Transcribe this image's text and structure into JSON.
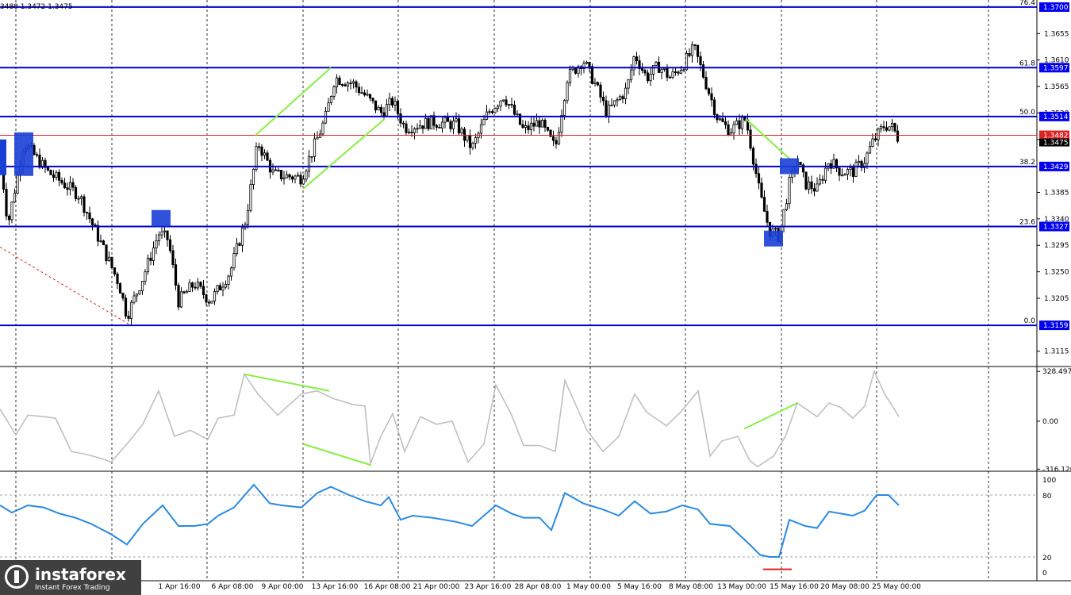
{
  "header": {
    "ohlc_text": "3480 1.3472 1.3475"
  },
  "brand": {
    "name": "instaforex",
    "tagline": "Instant Forex Trading"
  },
  "colors": {
    "level": "#0000cc",
    "level_label_bg": "#0000ee",
    "current_price": "#dd2222",
    "trend_green": "#88ee44",
    "marker_blue": "#1a3fd6",
    "oscillator": "#c0c0c0",
    "rsi": "#2a8ae0",
    "candle": "#000000",
    "grid": "#000000"
  },
  "chart_data": [
    {
      "type": "candlestick",
      "pane": "price",
      "title": "",
      "x_labels": [
        "1 Apr 16:00",
        "6 Apr 08:00",
        "9 Apr 00:00",
        "13 Apr 16:00",
        "16 Apr 08:00",
        "21 Apr 00:00",
        "23 Apr 16:00",
        "28 Apr 08:00",
        "1 May 00:00",
        "5 May 16:00",
        "8 May 08:00",
        "13 May 00:00",
        "15 May 16:00",
        "20 May 08:00",
        "25 May 00:00"
      ],
      "y_ticks": [
        "1.3655",
        "1.3610",
        "1.3565",
        "1.3520",
        "1.3475",
        "1.3385",
        "1.3340",
        "1.3295",
        "1.3250",
        "1.3205",
        "1.3115"
      ],
      "ylim": [
        1.3089,
        1.3712
      ],
      "grid": true,
      "close_anchors": [
        [
          0,
          1.345
        ],
        [
          10,
          1.333
        ],
        [
          30,
          1.347
        ],
        [
          60,
          1.342
        ],
        [
          100,
          1.338
        ],
        [
          150,
          1.323
        ],
        [
          160,
          1.3175
        ],
        [
          180,
          1.324
        ],
        [
          200,
          1.3315
        ],
        [
          212,
          1.3305
        ],
        [
          225,
          1.32
        ],
        [
          245,
          1.323
        ],
        [
          265,
          1.32
        ],
        [
          290,
          1.325
        ],
        [
          310,
          1.334
        ],
        [
          325,
          1.347
        ],
        [
          345,
          1.3415
        ],
        [
          380,
          1.341
        ],
        [
          410,
          1.351
        ],
        [
          422,
          1.358
        ],
        [
          445,
          1.357
        ],
        [
          460,
          1.355
        ],
        [
          480,
          1.352
        ],
        [
          495,
          1.354
        ],
        [
          510,
          1.3495
        ],
        [
          545,
          1.3505
        ],
        [
          575,
          1.35
        ],
        [
          595,
          1.346
        ],
        [
          615,
          1.352
        ],
        [
          635,
          1.355
        ],
        [
          660,
          1.349
        ],
        [
          680,
          1.3505
        ],
        [
          700,
          1.346
        ],
        [
          715,
          1.358
        ],
        [
          735,
          1.361
        ],
        [
          750,
          1.357
        ],
        [
          765,
          1.352
        ],
        [
          790,
          1.356
        ],
        [
          800,
          1.362
        ],
        [
          815,
          1.358
        ],
        [
          830,
          1.36
        ],
        [
          845,
          1.358
        ],
        [
          860,
          1.36
        ],
        [
          875,
          1.363
        ],
        [
          890,
          1.357
        ],
        [
          905,
          1.351
        ],
        [
          920,
          1.349
        ],
        [
          940,
          1.351
        ],
        [
          950,
          1.344
        ],
        [
          958,
          1.338
        ],
        [
          970,
          1.332
        ],
        [
          982,
          1.331
        ],
        [
          995,
          1.34
        ],
        [
          1005,
          1.344
        ],
        [
          1015,
          1.34
        ],
        [
          1030,
          1.339
        ],
        [
          1045,
          1.344
        ],
        [
          1060,
          1.342
        ],
        [
          1075,
          1.342
        ],
        [
          1090,
          1.344
        ],
        [
          1100,
          1.347
        ],
        [
          1115,
          1.35
        ],
        [
          1125,
          1.3495
        ],
        [
          1133,
          1.3475
        ]
      ],
      "horizontal_levels": [
        {
          "fib": "76.4",
          "price": 1.37,
          "label": "1.3700"
        },
        {
          "fib": "61.8",
          "price": 1.3597,
          "label": "1.3597"
        },
        {
          "fib": "50.0",
          "price": 1.3514,
          "label": "1.3514"
        },
        {
          "fib": "38.2",
          "price": 1.3429,
          "label": "1.3429"
        },
        {
          "fib": "23.6",
          "price": 1.3327,
          "label": "1.3327"
        },
        {
          "fib": "0.0",
          "price": 1.3159,
          "label": "1.3159"
        }
      ],
      "current_price": {
        "price": 1.3482,
        "label": "1.3482",
        "last": "1.3475"
      },
      "trend_lines": [
        {
          "from": [
            322,
            1.3482
          ],
          "to": [
            417,
            1.3597
          ]
        },
        {
          "from": [
            382,
            1.3391
          ],
          "to": [
            485,
            1.351
          ]
        },
        {
          "from": [
            940,
            1.351
          ],
          "to": [
            997,
            1.344
          ]
        }
      ],
      "markers": [
        {
          "x": 30,
          "from": 1.3487,
          "to": 1.3413
        },
        {
          "x": 203,
          "from": 1.3355,
          "to": 1.3327
        },
        {
          "x": 975,
          "from": 1.332,
          "to": 1.3295
        },
        {
          "x": 995,
          "from": 1.3443,
          "to": 1.3429
        }
      ]
    },
    {
      "type": "line",
      "pane": "oscillator",
      "y_ticks": [
        "328.4976",
        "0.00",
        "-316.1207"
      ],
      "ylim": [
        -330,
        340
      ],
      "series": [
        {
          "points": [
            [
              0,
              80
            ],
            [
              20,
              -90
            ],
            [
              35,
              40
            ],
            [
              55,
              30
            ],
            [
              70,
              20
            ],
            [
              90,
              -200
            ],
            [
              110,
              -220
            ],
            [
              130,
              -250
            ],
            [
              140,
              -270
            ],
            [
              160,
              -150
            ],
            [
              180,
              -20
            ],
            [
              200,
              200
            ],
            [
              220,
              -100
            ],
            [
              240,
              -60
            ],
            [
              262,
              -120
            ],
            [
              275,
              20
            ],
            [
              295,
              40
            ],
            [
              308,
              310
            ],
            [
              325,
              180
            ],
            [
              350,
              40
            ],
            [
              380,
              180
            ],
            [
              400,
              200
            ],
            [
              420,
              150
            ],
            [
              445,
              110
            ],
            [
              460,
              100
            ],
            [
              467,
              -280
            ],
            [
              480,
              -100
            ],
            [
              495,
              50
            ],
            [
              510,
              -200
            ],
            [
              530,
              30
            ],
            [
              550,
              -20
            ],
            [
              570,
              0
            ],
            [
              590,
              -270
            ],
            [
              610,
              -150
            ],
            [
              625,
              240
            ],
            [
              645,
              40
            ],
            [
              660,
              -160
            ],
            [
              680,
              -160
            ],
            [
              700,
              -200
            ],
            [
              712,
              270
            ],
            [
              740,
              -60
            ],
            [
              760,
              -200
            ],
            [
              780,
              -100
            ],
            [
              800,
              180
            ],
            [
              815,
              60
            ],
            [
              840,
              -30
            ],
            [
              858,
              60
            ],
            [
              880,
              200
            ],
            [
              895,
              -230
            ],
            [
              910,
              -130
            ],
            [
              930,
              -100
            ],
            [
              945,
              -260
            ],
            [
              955,
              -300
            ],
            [
              975,
              -230
            ],
            [
              990,
              -100
            ],
            [
              1005,
              120
            ],
            [
              1030,
              30
            ],
            [
              1045,
              120
            ],
            [
              1060,
              90
            ],
            [
              1075,
              20
            ],
            [
              1090,
              100
            ],
            [
              1102,
              330
            ],
            [
              1115,
              180
            ],
            [
              1125,
              100
            ],
            [
              1133,
              30
            ]
          ]
        }
      ],
      "trend_lines": [
        {
          "from": [
            308,
            310
          ],
          "to": [
            415,
            200
          ]
        },
        {
          "from": [
            382,
            -150
          ],
          "to": [
            468,
            -290
          ]
        },
        {
          "from": [
            938,
            -50
          ],
          "to": [
            1005,
            120
          ]
        }
      ]
    },
    {
      "type": "line",
      "pane": "rsi",
      "y_ticks": [
        "100",
        "80",
        "20",
        "0"
      ],
      "ylim": [
        0,
        100
      ],
      "levels": [
        80,
        20
      ],
      "series": [
        {
          "points": [
            [
              0,
              70
            ],
            [
              15,
              63
            ],
            [
              35,
              70
            ],
            [
              55,
              68
            ],
            [
              75,
              62
            ],
            [
              95,
              58
            ],
            [
              115,
              52
            ],
            [
              140,
              42
            ],
            [
              160,
              32
            ],
            [
              180,
              52
            ],
            [
              205,
              70
            ],
            [
              225,
              50
            ],
            [
              245,
              50
            ],
            [
              262,
              52
            ],
            [
              275,
              60
            ],
            [
              295,
              68
            ],
            [
              320,
              90
            ],
            [
              340,
              72
            ],
            [
              355,
              70
            ],
            [
              380,
              68
            ],
            [
              400,
              82
            ],
            [
              417,
              88
            ],
            [
              440,
              80
            ],
            [
              460,
              74
            ],
            [
              480,
              70
            ],
            [
              490,
              78
            ],
            [
              505,
              56
            ],
            [
              520,
              60
            ],
            [
              545,
              58
            ],
            [
              575,
              54
            ],
            [
              595,
              50
            ],
            [
              625,
              70
            ],
            [
              645,
              62
            ],
            [
              660,
              58
            ],
            [
              680,
              58
            ],
            [
              695,
              46
            ],
            [
              712,
              82
            ],
            [
              735,
              72
            ],
            [
              760,
              66
            ],
            [
              780,
              60
            ],
            [
              800,
              74
            ],
            [
              820,
              62
            ],
            [
              840,
              64
            ],
            [
              860,
              70
            ],
            [
              880,
              66
            ],
            [
              895,
              52
            ],
            [
              920,
              50
            ],
            [
              945,
              32
            ],
            [
              958,
              22
            ],
            [
              970,
              20
            ],
            [
              982,
              20
            ],
            [
              995,
              56
            ],
            [
              1015,
              50
            ],
            [
              1030,
              48
            ],
            [
              1045,
              64
            ],
            [
              1060,
              62
            ],
            [
              1075,
              60
            ],
            [
              1090,
              65
            ],
            [
              1105,
              80
            ],
            [
              1120,
              80
            ],
            [
              1133,
              70
            ]
          ]
        }
      ],
      "marker": {
        "value": 8,
        "from": 962,
        "to": 998
      }
    }
  ]
}
